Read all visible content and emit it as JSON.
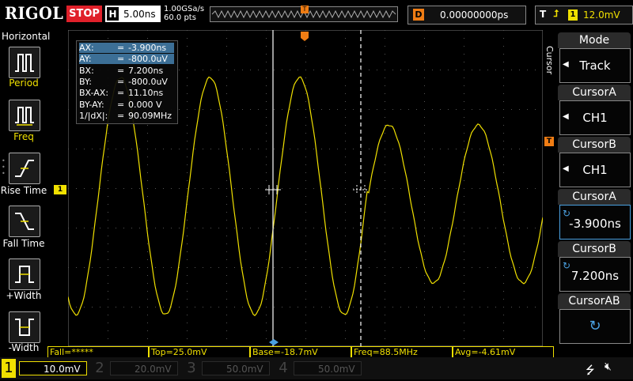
{
  "header": {
    "brand": "RIGOL",
    "run_state": "STOP",
    "timebase_key": "H",
    "timebase_value": "5.00ns",
    "sample_rate": "1.00GSa/s",
    "memory_depth": "60.0 pts",
    "delay_key": "D",
    "delay_value": "0.00000000ps",
    "trigger_key": "T",
    "trigger_channel": "1",
    "trigger_level": "12.0mV"
  },
  "left_menu": {
    "title": "Horizontal",
    "items": [
      {
        "label": "Period",
        "icon": "period-icon"
      },
      {
        "label": "Freq",
        "icon": "freq-icon"
      },
      {
        "label": "Rise Time",
        "icon": "rise-time-icon"
      },
      {
        "label": "Fall Time",
        "icon": "fall-time-icon"
      },
      {
        "label": "+Width",
        "icon": "positive-width-icon"
      },
      {
        "label": "-Width",
        "icon": "negative-width-icon"
      }
    ]
  },
  "cursor_readout": {
    "rows": [
      {
        "key": "AX:",
        "eq": "=",
        "value": "-3.900ns",
        "selected": true
      },
      {
        "key": "AY:",
        "eq": "=",
        "value": "-800.0uV",
        "selected": true
      },
      {
        "key": "BX:",
        "eq": "=",
        "value": "7.200ns",
        "selected": false
      },
      {
        "key": "BY:",
        "eq": "=",
        "value": "-800.0uV",
        "selected": false
      },
      {
        "key": "BX-AX:",
        "eq": "=",
        "value": "11.10ns",
        "selected": false
      },
      {
        "key": "BY-AY:",
        "eq": "=",
        "value": "0.000 V",
        "selected": false
      },
      {
        "key": "1/|dX|:",
        "eq": "=",
        "value": "90.09MHz",
        "selected": false
      }
    ]
  },
  "right_menu": {
    "title": "Cursor",
    "items": [
      {
        "label": "Mode",
        "value": "Track",
        "kind": "select"
      },
      {
        "label": "CursorA",
        "value": "CH1",
        "kind": "select"
      },
      {
        "label": "CursorB",
        "value": "CH1",
        "kind": "select"
      },
      {
        "label": "CursorA",
        "value": "-3.900ns",
        "kind": "knob"
      },
      {
        "label": "CursorB",
        "value": "7.200ns",
        "kind": "knob"
      },
      {
        "label": "CursorAB",
        "value": "",
        "kind": "knob"
      }
    ]
  },
  "measurements": {
    "fall": "Fall=*****",
    "top": "Top=25.0mV",
    "base": "Base=-18.7mV",
    "freq": "Freq=88.5MHz",
    "avg": "Avg=-4.61mV"
  },
  "channels": [
    {
      "num": "1",
      "scale": "10.0mV",
      "active": true
    },
    {
      "num": "2",
      "scale": "20.0mV",
      "active": false
    },
    {
      "num": "3",
      "scale": "50.0mV",
      "active": false
    },
    {
      "num": "4",
      "scale": "50.0mV",
      "active": false
    }
  ],
  "markers": {
    "trigger_position": "T",
    "channel_marker": "1",
    "trigger_level_marker": "T"
  },
  "colors": {
    "ch1": "#f0e000",
    "stop": "#e0202a",
    "trigger": "#f07d14",
    "selected": "#3c6f96"
  }
}
